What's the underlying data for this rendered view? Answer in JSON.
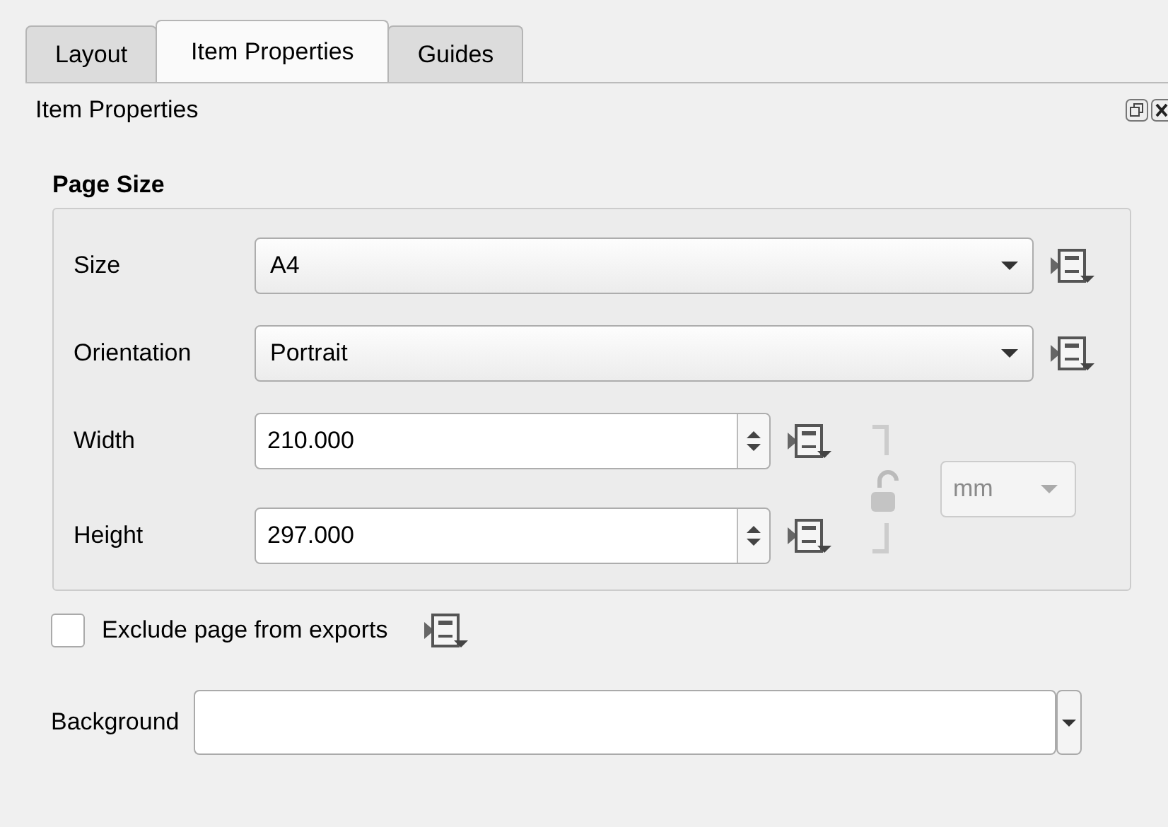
{
  "tabs": [
    {
      "label": "Layout",
      "selected": false
    },
    {
      "label": "Item Properties",
      "selected": true
    },
    {
      "label": "Guides",
      "selected": false
    }
  ],
  "panel": {
    "title": "Item Properties"
  },
  "page_size": {
    "title": "Page Size",
    "fields": [
      {
        "kind": "combo",
        "label": "Size",
        "value": "A4"
      },
      {
        "kind": "combo",
        "label": "Orientation",
        "value": "Portrait"
      },
      {
        "kind": "spin",
        "label": "Width",
        "value": "210.000"
      },
      {
        "kind": "spin",
        "label": "Height",
        "value": "297.000"
      }
    ],
    "ratio_locked": false,
    "unit": "mm",
    "unit_disabled": true
  },
  "exclude": {
    "label": "Exclude page from exports",
    "checked": false
  },
  "background": {
    "label": "Background"
  }
}
